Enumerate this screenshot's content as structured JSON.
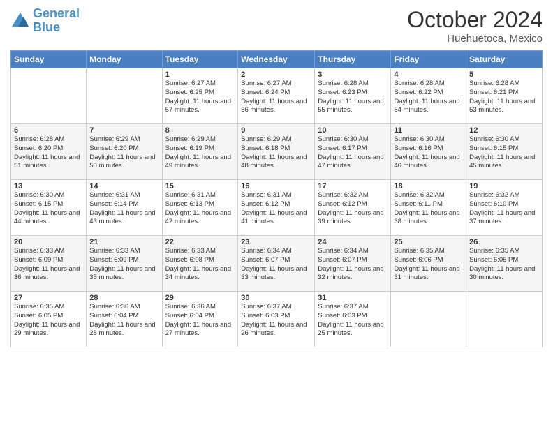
{
  "header": {
    "logo_line1": "General",
    "logo_line2": "Blue",
    "month": "October 2024",
    "location": "Huehuetoca, Mexico"
  },
  "days_of_week": [
    "Sunday",
    "Monday",
    "Tuesday",
    "Wednesday",
    "Thursday",
    "Friday",
    "Saturday"
  ],
  "weeks": [
    [
      {
        "day": "",
        "sunrise": "",
        "sunset": "",
        "daylight": ""
      },
      {
        "day": "",
        "sunrise": "",
        "sunset": "",
        "daylight": ""
      },
      {
        "day": "1",
        "sunrise": "Sunrise: 6:27 AM",
        "sunset": "Sunset: 6:25 PM",
        "daylight": "Daylight: 11 hours and 57 minutes."
      },
      {
        "day": "2",
        "sunrise": "Sunrise: 6:27 AM",
        "sunset": "Sunset: 6:24 PM",
        "daylight": "Daylight: 11 hours and 56 minutes."
      },
      {
        "day": "3",
        "sunrise": "Sunrise: 6:28 AM",
        "sunset": "Sunset: 6:23 PM",
        "daylight": "Daylight: 11 hours and 55 minutes."
      },
      {
        "day": "4",
        "sunrise": "Sunrise: 6:28 AM",
        "sunset": "Sunset: 6:22 PM",
        "daylight": "Daylight: 11 hours and 54 minutes."
      },
      {
        "day": "5",
        "sunrise": "Sunrise: 6:28 AM",
        "sunset": "Sunset: 6:21 PM",
        "daylight": "Daylight: 11 hours and 53 minutes."
      }
    ],
    [
      {
        "day": "6",
        "sunrise": "Sunrise: 6:28 AM",
        "sunset": "Sunset: 6:20 PM",
        "daylight": "Daylight: 11 hours and 51 minutes."
      },
      {
        "day": "7",
        "sunrise": "Sunrise: 6:29 AM",
        "sunset": "Sunset: 6:20 PM",
        "daylight": "Daylight: 11 hours and 50 minutes."
      },
      {
        "day": "8",
        "sunrise": "Sunrise: 6:29 AM",
        "sunset": "Sunset: 6:19 PM",
        "daylight": "Daylight: 11 hours and 49 minutes."
      },
      {
        "day": "9",
        "sunrise": "Sunrise: 6:29 AM",
        "sunset": "Sunset: 6:18 PM",
        "daylight": "Daylight: 11 hours and 48 minutes."
      },
      {
        "day": "10",
        "sunrise": "Sunrise: 6:30 AM",
        "sunset": "Sunset: 6:17 PM",
        "daylight": "Daylight: 11 hours and 47 minutes."
      },
      {
        "day": "11",
        "sunrise": "Sunrise: 6:30 AM",
        "sunset": "Sunset: 6:16 PM",
        "daylight": "Daylight: 11 hours and 46 minutes."
      },
      {
        "day": "12",
        "sunrise": "Sunrise: 6:30 AM",
        "sunset": "Sunset: 6:15 PM",
        "daylight": "Daylight: 11 hours and 45 minutes."
      }
    ],
    [
      {
        "day": "13",
        "sunrise": "Sunrise: 6:30 AM",
        "sunset": "Sunset: 6:15 PM",
        "daylight": "Daylight: 11 hours and 44 minutes."
      },
      {
        "day": "14",
        "sunrise": "Sunrise: 6:31 AM",
        "sunset": "Sunset: 6:14 PM",
        "daylight": "Daylight: 11 hours and 43 minutes."
      },
      {
        "day": "15",
        "sunrise": "Sunrise: 6:31 AM",
        "sunset": "Sunset: 6:13 PM",
        "daylight": "Daylight: 11 hours and 42 minutes."
      },
      {
        "day": "16",
        "sunrise": "Sunrise: 6:31 AM",
        "sunset": "Sunset: 6:12 PM",
        "daylight": "Daylight: 11 hours and 41 minutes."
      },
      {
        "day": "17",
        "sunrise": "Sunrise: 6:32 AM",
        "sunset": "Sunset: 6:12 PM",
        "daylight": "Daylight: 11 hours and 39 minutes."
      },
      {
        "day": "18",
        "sunrise": "Sunrise: 6:32 AM",
        "sunset": "Sunset: 6:11 PM",
        "daylight": "Daylight: 11 hours and 38 minutes."
      },
      {
        "day": "19",
        "sunrise": "Sunrise: 6:32 AM",
        "sunset": "Sunset: 6:10 PM",
        "daylight": "Daylight: 11 hours and 37 minutes."
      }
    ],
    [
      {
        "day": "20",
        "sunrise": "Sunrise: 6:33 AM",
        "sunset": "Sunset: 6:09 PM",
        "daylight": "Daylight: 11 hours and 36 minutes."
      },
      {
        "day": "21",
        "sunrise": "Sunrise: 6:33 AM",
        "sunset": "Sunset: 6:09 PM",
        "daylight": "Daylight: 11 hours and 35 minutes."
      },
      {
        "day": "22",
        "sunrise": "Sunrise: 6:33 AM",
        "sunset": "Sunset: 6:08 PM",
        "daylight": "Daylight: 11 hours and 34 minutes."
      },
      {
        "day": "23",
        "sunrise": "Sunrise: 6:34 AM",
        "sunset": "Sunset: 6:07 PM",
        "daylight": "Daylight: 11 hours and 33 minutes."
      },
      {
        "day": "24",
        "sunrise": "Sunrise: 6:34 AM",
        "sunset": "Sunset: 6:07 PM",
        "daylight": "Daylight: 11 hours and 32 minutes."
      },
      {
        "day": "25",
        "sunrise": "Sunrise: 6:35 AM",
        "sunset": "Sunset: 6:06 PM",
        "daylight": "Daylight: 11 hours and 31 minutes."
      },
      {
        "day": "26",
        "sunrise": "Sunrise: 6:35 AM",
        "sunset": "Sunset: 6:05 PM",
        "daylight": "Daylight: 11 hours and 30 minutes."
      }
    ],
    [
      {
        "day": "27",
        "sunrise": "Sunrise: 6:35 AM",
        "sunset": "Sunset: 6:05 PM",
        "daylight": "Daylight: 11 hours and 29 minutes."
      },
      {
        "day": "28",
        "sunrise": "Sunrise: 6:36 AM",
        "sunset": "Sunset: 6:04 PM",
        "daylight": "Daylight: 11 hours and 28 minutes."
      },
      {
        "day": "29",
        "sunrise": "Sunrise: 6:36 AM",
        "sunset": "Sunset: 6:04 PM",
        "daylight": "Daylight: 11 hours and 27 minutes."
      },
      {
        "day": "30",
        "sunrise": "Sunrise: 6:37 AM",
        "sunset": "Sunset: 6:03 PM",
        "daylight": "Daylight: 11 hours and 26 minutes."
      },
      {
        "day": "31",
        "sunrise": "Sunrise: 6:37 AM",
        "sunset": "Sunset: 6:03 PM",
        "daylight": "Daylight: 11 hours and 25 minutes."
      },
      {
        "day": "",
        "sunrise": "",
        "sunset": "",
        "daylight": ""
      },
      {
        "day": "",
        "sunrise": "",
        "sunset": "",
        "daylight": ""
      }
    ]
  ]
}
